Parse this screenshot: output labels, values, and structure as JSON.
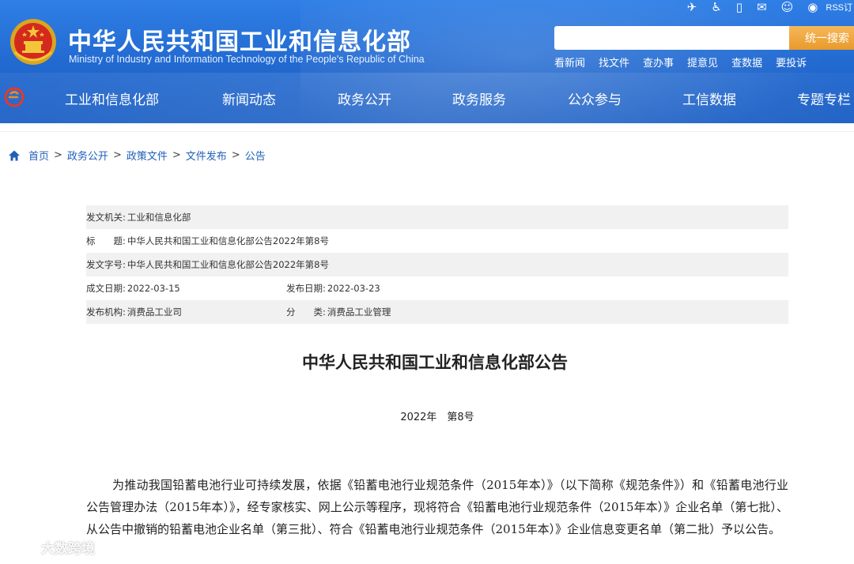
{
  "header": {
    "site_title": "中华人民共和国工业和信息化部",
    "site_subtitle": "Ministry of Industry and Information Technology of the People's Republic of China",
    "top_icons": [
      "plane-icon",
      "accessibility-icon",
      "mobile-icon",
      "mail-icon",
      "weixin-icon",
      "weibo-icon"
    ],
    "rss_label": "RSS订",
    "search": {
      "placeholder": "",
      "button_label": "统一搜索"
    },
    "quick_links": [
      "看新闻",
      "找文件",
      "查办事",
      "提意见",
      "查数据",
      "要投诉"
    ],
    "nav_items": [
      "工业和信息化部",
      "新闻动态",
      "政务公开",
      "政务服务",
      "公众参与",
      "工信数据",
      "专题专栏"
    ]
  },
  "breadcrumb": [
    "首页",
    "政务公开",
    "政策文件",
    "文件发布",
    "公告"
  ],
  "breadcrumb_separator": ">",
  "info": {
    "issuer_label": "发文机关:",
    "issuer_value": "工业和信息化部",
    "title_label": "标　　题:",
    "title_value": "中华人民共和国工业和信息化部公告2022年第8号",
    "docno_label": "发文字号:",
    "docno_value": "中华人民共和国工业和信息化部公告2022年第8号",
    "created_label": "成文日期:",
    "created_value": "2022-03-15",
    "published_label": "发布日期:",
    "published_value": "2022-03-23",
    "org_label": "发布机构:",
    "org_value": "消费品工业司",
    "category_label": "分　　类:",
    "category_value": "消费品工业管理"
  },
  "article": {
    "title": "中华人民共和国工业和信息化部公告",
    "number": "2022年　第8号",
    "body": "为推动我国铅蓄电池行业可持续发展，依据《铅蓄电池行业规范条件（2015年本）》（以下简称《规范条件》）和《铅蓄电池行业公告管理办法（2015年本）》，经专家核实、网上公示等程序，现将符合《铅蓄电池行业规范条件（2015年本）》企业名单（第七批）、从公告中撤销的铅蓄电池企业名单（第三批）、符合《铅蓄电池行业规范条件（2015年本）》企业信息变更名单（第二批）予以公告。"
  },
  "watermark": "大数跨境",
  "colors": {
    "header_blue": "#2168cf",
    "search_orange": "#e99a2c",
    "link_blue": "#1f5fb8",
    "row_shade": "#f1f1f1"
  }
}
